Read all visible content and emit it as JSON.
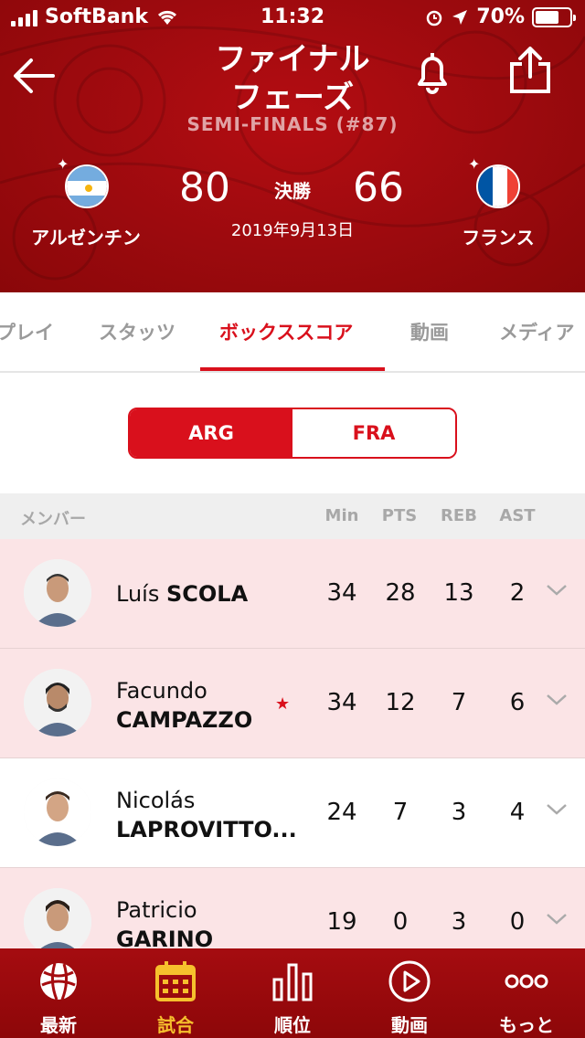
{
  "status_bar": {
    "carrier": "SoftBank",
    "time": "11:32",
    "battery": "70%",
    "battery_level": 0.7
  },
  "header": {
    "title_line1": "ファイナル",
    "title_line2": "フェーズ",
    "subtitle": "SEMI-FINALS (#87)",
    "home_team": "アルゼンチン",
    "away_team": "フランス",
    "home_score": "80",
    "away_score": "66",
    "stage": "決勝",
    "date": "2019年9月13日"
  },
  "tabs": [
    {
      "label": "プレイ"
    },
    {
      "label": "スタッツ"
    },
    {
      "label": "ボックススコア",
      "active": true
    },
    {
      "label": "動画"
    },
    {
      "label": "メディア"
    }
  ],
  "team_toggle": {
    "selected": "ARG",
    "options": [
      "ARG",
      "FRA"
    ]
  },
  "table": {
    "headers": {
      "member": "メンバー",
      "min": "Min",
      "pts": "PTS",
      "reb": "REB",
      "ast": "AST"
    },
    "rows": [
      {
        "first": "Luís",
        "last": "SCOLA",
        "min": "34",
        "pts": "28",
        "reb": "13",
        "ast": "2",
        "highlight": true
      },
      {
        "first": "Facundo",
        "last": "CAMPAZZO",
        "min": "34",
        "pts": "12",
        "reb": "7",
        "ast": "6",
        "highlight": true,
        "star": "★"
      },
      {
        "first": "Nicolás",
        "last": "LAPROVITTO...",
        "min": "24",
        "pts": "7",
        "reb": "3",
        "ast": "4",
        "highlight": false
      },
      {
        "first": "Patricio",
        "last": "GARINO",
        "min": "19",
        "pts": "0",
        "reb": "3",
        "ast": "0",
        "highlight": true
      }
    ]
  },
  "bottom_nav": [
    {
      "label": "最新",
      "icon": "basketball-icon"
    },
    {
      "label": "試合",
      "icon": "calendar-icon",
      "active": true
    },
    {
      "label": "順位",
      "icon": "bar-chart-icon"
    },
    {
      "label": "動画",
      "icon": "play-icon"
    },
    {
      "label": "もっと",
      "icon": "more-icon"
    }
  ],
  "colors": {
    "brand_red": "#d9101c",
    "header_red": "#a50c10",
    "active_nav": "#f6c02d",
    "row_highlight": "#fbe4e6"
  }
}
